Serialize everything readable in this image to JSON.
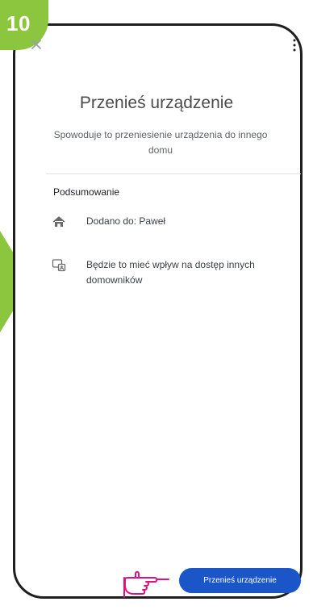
{
  "step_badge": {
    "number": "10"
  },
  "screen": {
    "title": "Przenieś urządzenie",
    "subtitle": "Spowoduje to przeniesienie urządzenia do innego domu",
    "section_title": "Podsumowanie",
    "items": [
      {
        "icon": "home-icon",
        "text": "Dodano do: Paweł"
      },
      {
        "icon": "members-icon",
        "text": "Będzie to mieć wpływ na dostęp innych domowników"
      }
    ],
    "primary_button": "Przenieś urządzenie"
  },
  "colors": {
    "accent_green": "#8cc63f",
    "primary_blue": "#1a56c7",
    "pointer_magenta": "#e0117f"
  },
  "icons": {
    "close": "close-icon",
    "more": "more-vertical-icon",
    "pointer": "pointing-hand-icon"
  }
}
